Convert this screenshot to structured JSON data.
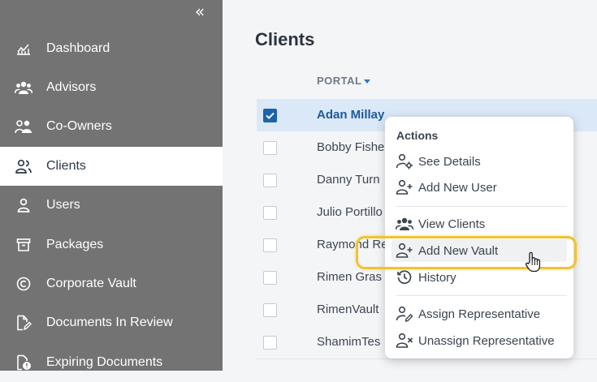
{
  "sidebar": {
    "collapse_icon": "«",
    "items": [
      {
        "label": "Dashboard",
        "icon": "chart-line-icon"
      },
      {
        "label": "Advisors",
        "icon": "users-group-icon"
      },
      {
        "label": "Co-Owners",
        "icon": "users-pair-icon"
      },
      {
        "label": "Clients",
        "icon": "client-icon",
        "active": true
      },
      {
        "label": "Users",
        "icon": "user-icon"
      },
      {
        "label": "Packages",
        "icon": "archive-box-icon"
      },
      {
        "label": "Corporate Vault",
        "icon": "copyright-icon"
      },
      {
        "label": "Documents In Review",
        "icon": "document-edit-icon"
      },
      {
        "label": "Expiring Documents",
        "icon": "document-alert-icon"
      }
    ]
  },
  "main": {
    "title": "Clients",
    "column_header": "PORTAL",
    "rows": [
      {
        "name": "Adan Millay",
        "checked": true
      },
      {
        "name": "Bobby Fishe",
        "checked": false
      },
      {
        "name": "Danny Turn",
        "checked": false
      },
      {
        "name": "Julio Portillo",
        "checked": false
      },
      {
        "name": "Raymond Re",
        "checked": false
      },
      {
        "name": "Rimen Gras",
        "checked": false
      },
      {
        "name": "RimenVault",
        "checked": false
      },
      {
        "name": "ShamimTes",
        "checked": false
      }
    ]
  },
  "menu": {
    "title": "Actions",
    "items": [
      {
        "label": "See Details",
        "icon": "user-gear-icon"
      },
      {
        "label": "Add New User",
        "icon": "user-plus-icon"
      },
      {
        "label": "View Clients",
        "icon": "users-group-icon"
      },
      {
        "label": "Add New Vault",
        "icon": "user-plus-icon",
        "highlighted": true
      },
      {
        "label": "History",
        "icon": "history-icon"
      },
      {
        "label": "Assign Representative",
        "icon": "user-edit-icon"
      },
      {
        "label": "Unassign Representative",
        "icon": "user-remove-icon"
      }
    ]
  },
  "colors": {
    "sidebar_bg": "#737373",
    "active_text": "#2d3a4a",
    "selected_row": "#dbe8f7",
    "link_blue": "#1e5a99",
    "highlight": "#f1c232"
  }
}
